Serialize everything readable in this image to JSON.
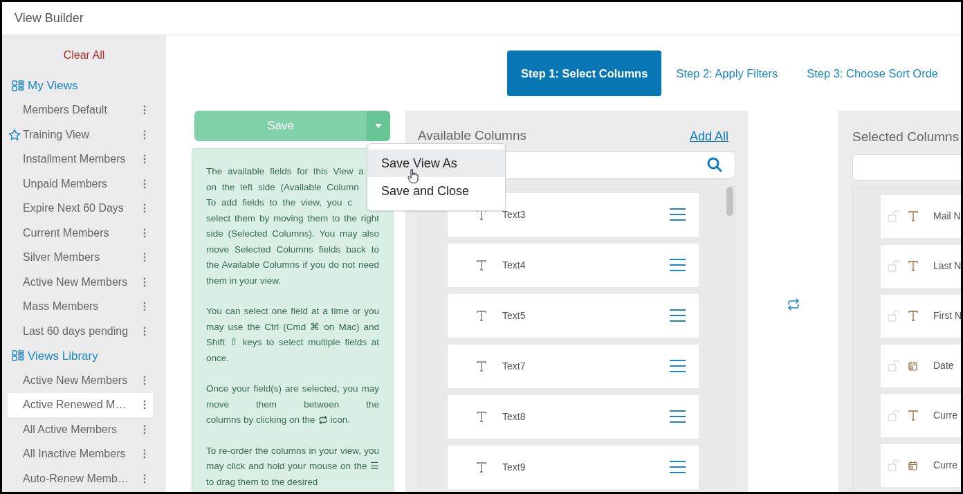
{
  "window": {
    "title": "View Builder"
  },
  "sidebar": {
    "clear_all": "Clear All",
    "sections": [
      {
        "title": "My Views",
        "items": [
          {
            "label": "Members Default",
            "favorite": false,
            "selected": false
          },
          {
            "label": "Training View",
            "favorite": true,
            "selected": false
          },
          {
            "label": "Installment Members",
            "favorite": false,
            "selected": false
          },
          {
            "label": "Unpaid Members",
            "favorite": false,
            "selected": false
          },
          {
            "label": "Expire Next 60 Days",
            "favorite": false,
            "selected": false
          },
          {
            "label": "Current Members",
            "favorite": false,
            "selected": false
          },
          {
            "label": "Silver Members",
            "favorite": false,
            "selected": false
          },
          {
            "label": "Active New Members",
            "favorite": false,
            "selected": false
          },
          {
            "label": "Mass Members",
            "favorite": false,
            "selected": false
          },
          {
            "label": "Last 60 days pending",
            "favorite": false,
            "selected": false
          }
        ]
      },
      {
        "title": "Views Library",
        "items": [
          {
            "label": "Active New Members",
            "favorite": false,
            "selected": false
          },
          {
            "label": "Active Renewed M…",
            "favorite": false,
            "selected": true
          },
          {
            "label": "All Active Members",
            "favorite": false,
            "selected": false
          },
          {
            "label": "All Inactive Members",
            "favorite": false,
            "selected": false
          },
          {
            "label": "Auto-Renew Memb…",
            "favorite": false,
            "selected": false
          }
        ]
      }
    ]
  },
  "steps": [
    {
      "label": "Step 1: Select Columns",
      "selected": true
    },
    {
      "label": "Step 2: Apply Filters",
      "selected": false
    },
    {
      "label": "Step 3: Choose Sort Orde",
      "selected": false
    }
  ],
  "save": {
    "label": "Save",
    "menu": [
      {
        "label": "Save View As",
        "selected": true
      },
      {
        "label": "Save and Close",
        "selected": false
      }
    ]
  },
  "info": {
    "cut_lines": [
      "The available fields for this View a",
      "on the left side (Available Column",
      "To add fields to the view, you c"
    ],
    "paragraphs": [
      {
        "parts": [
          {
            "kind": "text",
            "text": "select them by moving them to the right side (Selected Columns). You may also move Selected Columns fields back to the Available Columns if you do not need them in your view."
          }
        ]
      },
      {
        "parts": [
          {
            "kind": "text",
            "text": "You can select one field at a time or you may use the Ctrl (Cmd ⌘ on Mac) and Shift ⇧ keys to select multiple fields at once."
          }
        ]
      },
      {
        "parts": [
          {
            "kind": "text",
            "text": "Once your field(s) are selected, you may move them between the"
          },
          {
            "kind": "line",
            "pieces": [
              {
                "kind": "text",
                "text": "columns by clicking on the"
              },
              {
                "kind": "swap_icon"
              },
              {
                "kind": "text",
                "text": "icon."
              }
            ]
          }
        ]
      },
      {
        "parts": [
          {
            "kind": "text",
            "text": "To re-order the columns in your view, you may click and hold your mouse on the ☰ to drag them to the desired"
          }
        ]
      }
    ]
  },
  "available_columns": {
    "title": "Available Columns",
    "add_all": "Add All",
    "items": [
      {
        "label": "Text3",
        "kind": "text"
      },
      {
        "label": "Text4",
        "kind": "text"
      },
      {
        "label": "Text5",
        "kind": "text"
      },
      {
        "label": "Text7",
        "kind": "text"
      },
      {
        "label": "Text8",
        "kind": "text"
      },
      {
        "label": "Text9",
        "kind": "text"
      }
    ]
  },
  "selected_columns": {
    "title": "Selected Columns",
    "items": [
      {
        "label": "Mail N",
        "kind": "text"
      },
      {
        "label": "Last N",
        "kind": "text"
      },
      {
        "label": "First N",
        "kind": "text"
      },
      {
        "label": "Date",
        "kind": "date"
      },
      {
        "label": "Curre",
        "kind": "text"
      },
      {
        "label": "Curre",
        "kind": "date"
      }
    ]
  }
}
